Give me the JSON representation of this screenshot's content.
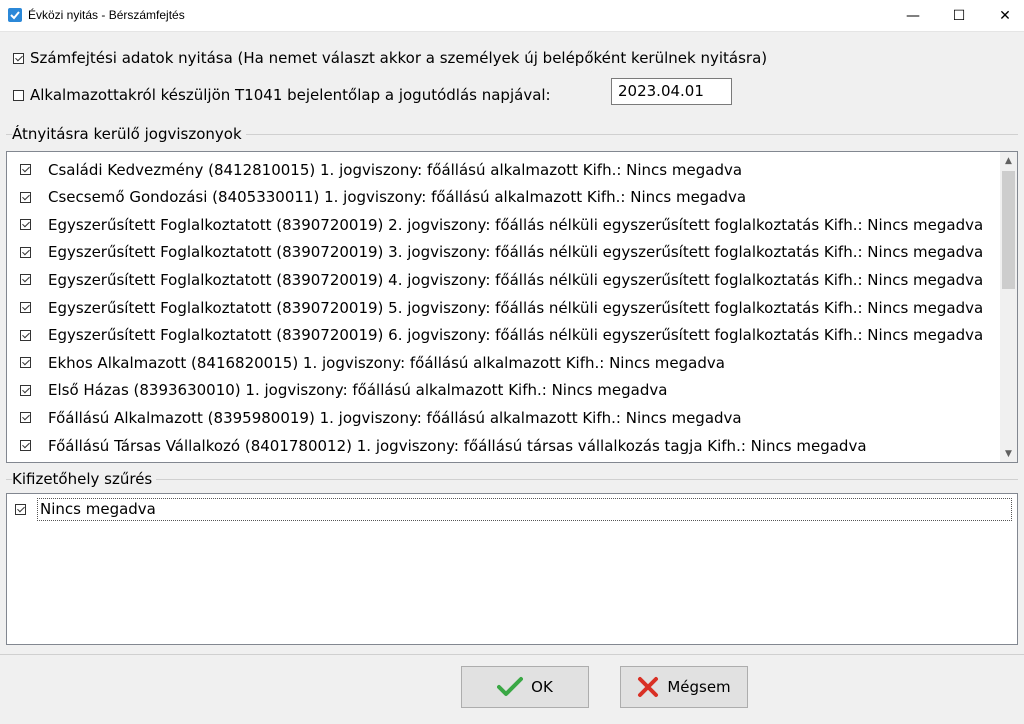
{
  "window": {
    "title": "Évközi nyitás - Bérszámfejtés",
    "min_glyph": "—",
    "max_glyph": "☐",
    "close_glyph": "✕"
  },
  "options": {
    "open_payroll_label": "Számfejtési adatok nyitása (Ha nemet választ akkor a személyek új belépőként kerülnek nyitásra)",
    "open_payroll_checked": true,
    "t1041_label": "Alkalmazottakról készüljön T1041 bejelentőlap a jogutódlás napjával:",
    "t1041_checked": false,
    "date_value": "2023.04.01"
  },
  "employments": {
    "group_label": "Átnyitásra kerülő jogviszonyok",
    "items": [
      {
        "label": "Családi Kedvezmény (8412810015) 1. jogviszony: főállású alkalmazott Kifh.: Nincs megadva",
        "checked": true
      },
      {
        "label": "Csecsemő Gondozási (8405330011) 1. jogviszony: főállású alkalmazott Kifh.: Nincs megadva",
        "checked": true
      },
      {
        "label": "Egyszerűsített Foglalkoztatott (8390720019) 2. jogviszony: főállás nélküli egyszerűsített foglalkoztatás Kifh.: Nincs megadva",
        "checked": true
      },
      {
        "label": "Egyszerűsített Foglalkoztatott (8390720019) 3. jogviszony: főállás nélküli egyszerűsített foglalkoztatás Kifh.: Nincs megadva",
        "checked": true
      },
      {
        "label": "Egyszerűsített Foglalkoztatott (8390720019) 4. jogviszony: főállás nélküli egyszerűsített foglalkoztatás Kifh.: Nincs megadva",
        "checked": true
      },
      {
        "label": "Egyszerűsített Foglalkoztatott (8390720019) 5. jogviszony: főállás nélküli egyszerűsített foglalkoztatás Kifh.: Nincs megadva",
        "checked": true
      },
      {
        "label": "Egyszerűsített Foglalkoztatott (8390720019) 6. jogviszony: főállás nélküli egyszerűsített foglalkoztatás Kifh.: Nincs megadva",
        "checked": true
      },
      {
        "label": "Ekhos Alkalmazott (8416820015) 1. jogviszony: főállású alkalmazott Kifh.: Nincs megadva",
        "checked": true
      },
      {
        "label": "Első Házas (8393630010) 1. jogviszony: főállású alkalmazott Kifh.: Nincs megadva",
        "checked": true
      },
      {
        "label": "Főállású Alkalmazott (8395980019) 1. jogviszony: főállású alkalmazott Kifh.: Nincs megadva",
        "checked": true
      },
      {
        "label": "Főállású Társas Vállalkozó (8401780012) 1. jogviszony: főállású társas vállalkozás tagja Kifh.: Nincs megadva",
        "checked": true
      }
    ]
  },
  "payer_filter": {
    "group_label": "Kifizetőhely szűrés",
    "items": [
      {
        "label": "Nincs megadva",
        "checked": true
      }
    ]
  },
  "buttons": {
    "ok_label": "OK",
    "cancel_label": "Mégsem",
    "ok_color": "#3aa845",
    "cancel_color": "#d93025"
  }
}
